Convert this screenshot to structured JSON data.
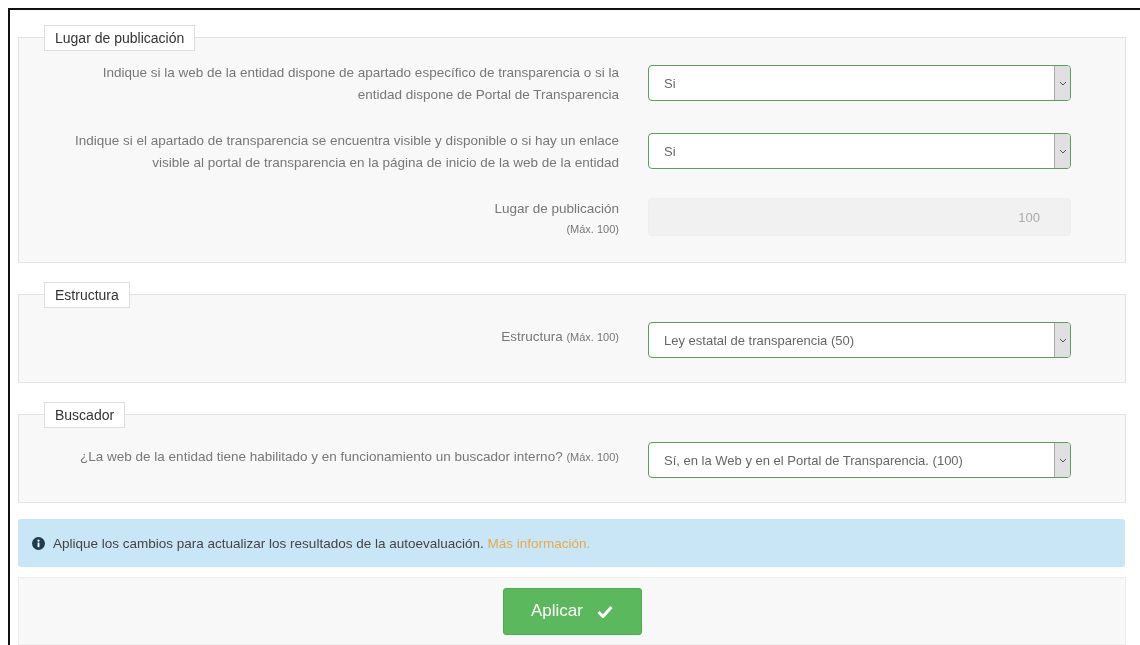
{
  "sections": [
    {
      "legend": "Lugar de publicación",
      "fields": [
        {
          "kind": "select",
          "label": "Indique si la web de la entidad dispone de apartado específico de transparencia o si la entidad dispone de Portal de Transparencia",
          "value": "Si"
        },
        {
          "kind": "select",
          "label": "Indique si el apartado de transparencia se encuentra visible y disponible o si hay un enlace visible al portal de transparencia en la página de inicio de la web de la entidad",
          "value": "Si"
        },
        {
          "kind": "text",
          "label": "Lugar de publicación",
          "note": "(Máx. 100)",
          "placeholder": "100",
          "disabled": true
        }
      ]
    },
    {
      "legend": "Estructura",
      "fields": [
        {
          "kind": "select",
          "label": "Estructura",
          "note": "(Máx. 100)",
          "value": "Ley estatal de transparencia (50)"
        }
      ]
    },
    {
      "legend": "Buscador",
      "fields": [
        {
          "kind": "select",
          "label": "¿La web de la entidad tiene habilitado y en funcionamiento un buscador interno?",
          "note": "(Máx. 100)",
          "value": "Sí, en la Web y en el Portal de Transparencia. (100)"
        }
      ]
    }
  ],
  "alert": {
    "text": "Aplique los cambios para actualizar los resultados de la autoevaluación.",
    "link": "Más información."
  },
  "apply_button": {
    "label": "Aplicar"
  }
}
